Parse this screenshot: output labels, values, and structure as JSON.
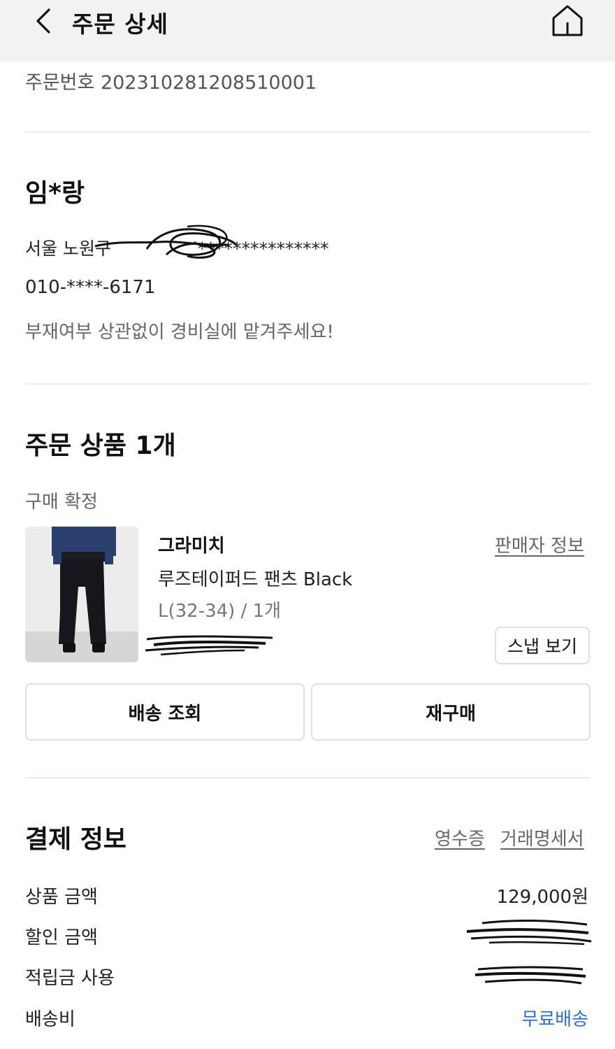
{
  "header": {
    "title": "주문 상세",
    "back_icon": "chevron-left-icon",
    "home_icon": "home-icon"
  },
  "order": {
    "number_text": "주문번호 202310281208510001"
  },
  "recipient": {
    "name": "임*랑",
    "address_prefix": "서울 노원구",
    "address_masked": "***************",
    "phone": "010-****-6171",
    "memo": "부재여부 상관없이 경비실에 맡겨주세요!"
  },
  "products": {
    "title": "주문 상품 1개",
    "status": "구매 확정",
    "item": {
      "brand": "그라미치",
      "name": "루즈테이퍼드 팬츠 Black",
      "option": "L(32-34) / 1개",
      "seller_info_link": "판매자 정보",
      "snap_button": "스냅 보기"
    },
    "buttons": {
      "track": "배송 조회",
      "reorder": "재구매"
    }
  },
  "payment": {
    "title": "결제 정보",
    "receipt_link": "영수증",
    "statement_link": "거래명세서",
    "rows": [
      {
        "label": "상품 금액",
        "value": "129,000원"
      },
      {
        "label": "할인 금액",
        "value": ""
      },
      {
        "label": "적립금 사용",
        "value": ""
      },
      {
        "label": "배송비",
        "value": "무료배송"
      }
    ],
    "accent_color": "#2f6fcf"
  }
}
